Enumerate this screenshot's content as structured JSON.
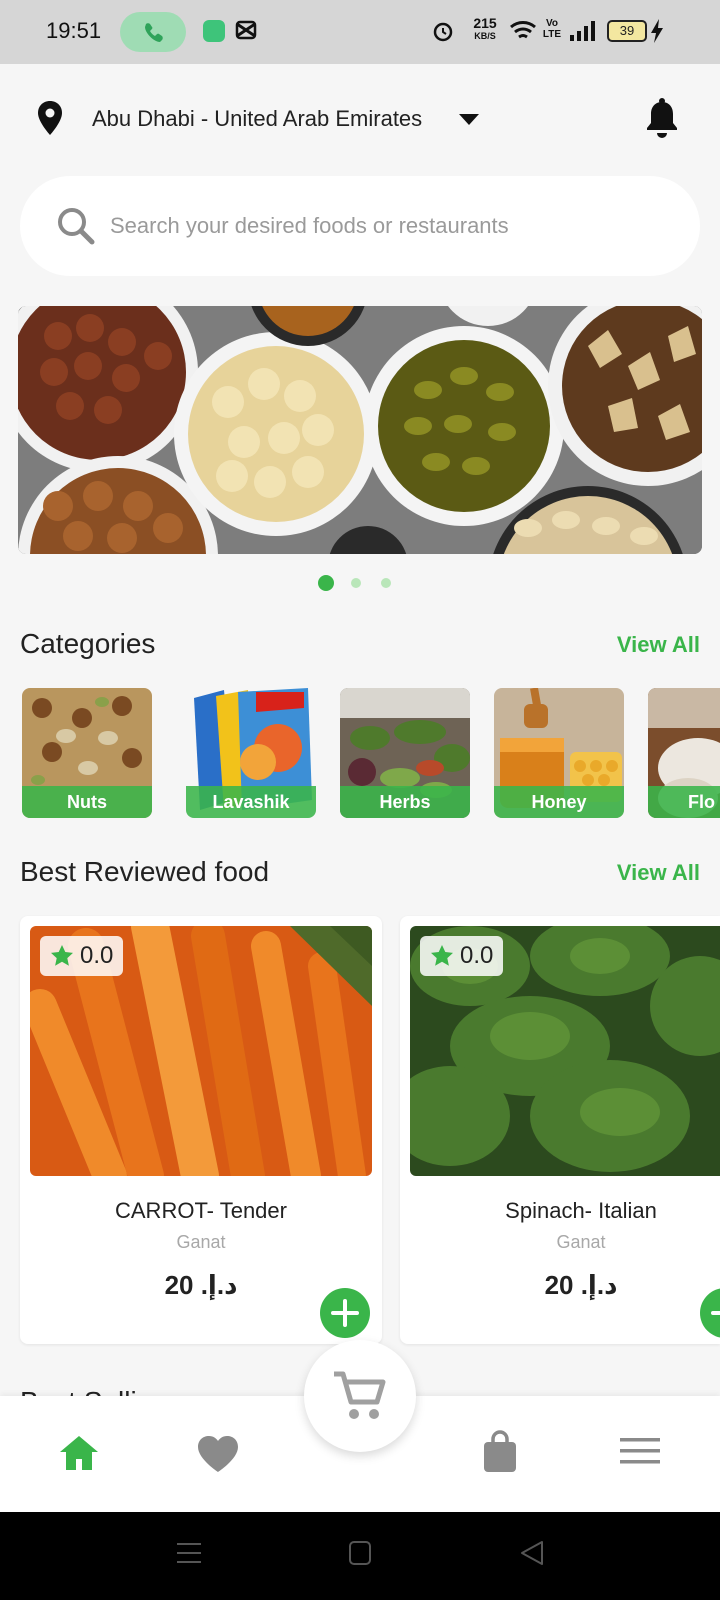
{
  "status_bar": {
    "time": "19:51",
    "net_speed": "215",
    "net_unit": "KB/S",
    "volte": "Vo LTE",
    "battery": "39"
  },
  "header": {
    "location": "Abu Dhabi - United Arab Emirates",
    "search_placeholder": "Search your desired foods or restaurants"
  },
  "banner": {
    "slides": 3,
    "active_slide": 1
  },
  "categories": {
    "title": "Categories",
    "view_all": "View All",
    "items": [
      {
        "label": "Nuts"
      },
      {
        "label": "Lavashik"
      },
      {
        "label": "Herbs"
      },
      {
        "label": "Honey"
      },
      {
        "label": "Flo"
      }
    ]
  },
  "best_reviewed": {
    "title": "Best Reviewed food",
    "view_all": "View All",
    "items": [
      {
        "rating": "0.0",
        "name": "CARROT- Tender",
        "store": "Ganat",
        "price": "د.إ. 20"
      },
      {
        "rating": "0.0",
        "name": "Spinach- Italian",
        "store": "Ganat",
        "price": "د.إ. 20"
      }
    ]
  },
  "next_section_peek": "Best Selli",
  "colors": {
    "accent": "#3ab54a",
    "background": "#f6f6f6"
  },
  "bottom_nav": {
    "items": [
      "home-icon",
      "heart-icon",
      "cart-icon",
      "bag-icon",
      "menu-icon"
    ],
    "active": "home-icon"
  }
}
